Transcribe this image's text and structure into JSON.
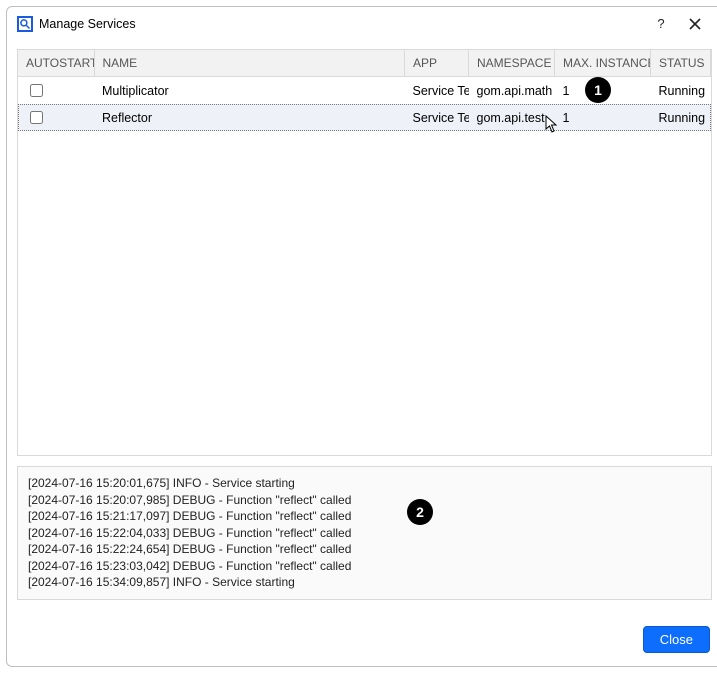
{
  "window": {
    "title": "Manage Services"
  },
  "columns": {
    "autostart": "AUTOSTART",
    "name": "NAME",
    "app": "APP",
    "namespace": "NAMESPACE",
    "max_instances": "MAX. INSTANCES",
    "status": "STATUS"
  },
  "rows": [
    {
      "name": "Multiplicator",
      "app": "Service Test",
      "namespace": "gom.api.math",
      "max_instances": "1",
      "status": "Running"
    },
    {
      "name": "Reflector",
      "app": "Service Test",
      "namespace": "gom.api.test",
      "max_instances": "1",
      "status": "Running"
    }
  ],
  "log": [
    "[2024-07-16 15:20:01,675] INFO - Service starting",
    "[2024-07-16 15:20:07,985] DEBUG - Function \"reflect\" called",
    "[2024-07-16 15:21:17,097] DEBUG - Function \"reflect\" called",
    "[2024-07-16 15:22:04,033] DEBUG - Function \"reflect\" called",
    "[2024-07-16 15:22:24,654] DEBUG - Function \"reflect\" called",
    "[2024-07-16 15:23:03,042] DEBUG - Function \"reflect\" called",
    "[2024-07-16 15:34:09,857] INFO - Service starting"
  ],
  "buttons": {
    "close": "Close"
  },
  "annotations": {
    "b1": "1",
    "b2": "2"
  }
}
